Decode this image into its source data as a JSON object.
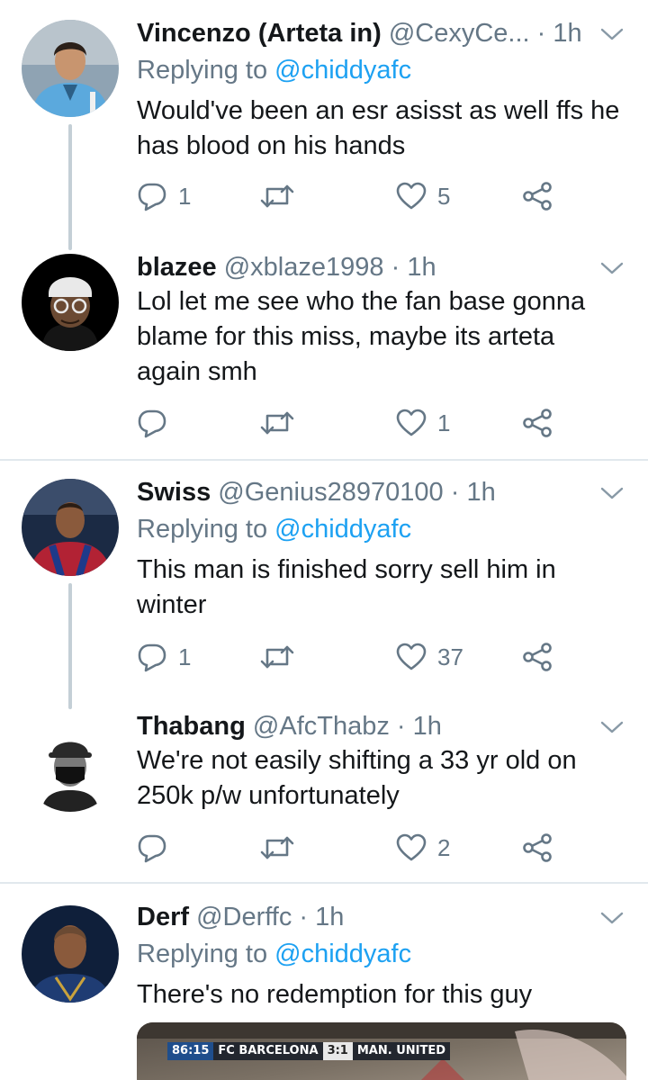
{
  "colors": {
    "text_primary": "#14171a",
    "text_secondary": "#657786",
    "link": "#1da1f2",
    "thread_line": "#c4cfd6",
    "divider": "#e1e8ed"
  },
  "icons": {
    "reply": "reply-icon",
    "retweet": "retweet-icon",
    "like": "heart-icon",
    "share": "share-icon",
    "more": "chevron-down-icon"
  },
  "tweets": [
    {
      "name": "Vincenzo (Arteta in)",
      "handle": "@CexyCe...",
      "dot": "·",
      "time": "1h",
      "replying_prefix": "Replying to",
      "replying_to": "@chiddyafc",
      "text": "Would've been an esr asisst as well ffs he has blood on his hands",
      "reply_count": "1",
      "like_count": "5"
    },
    {
      "name": "blazee",
      "handle": "@xblaze1998",
      "dot": "·",
      "time": "1h",
      "text": "Lol let me see who the fan base gonna blame for this miss, maybe its arteta again smh",
      "reply_count": "",
      "like_count": "1"
    },
    {
      "name": "Swiss",
      "handle": "@Genius28970100",
      "dot": "·",
      "time": "1h",
      "replying_prefix": "Replying to",
      "replying_to": "@chiddyafc",
      "text": "This man is finished sorry sell him in winter",
      "reply_count": "1",
      "like_count": "37"
    },
    {
      "name": "Thabang",
      "handle": "@AfcThabz",
      "dot": "·",
      "time": "1h",
      "text": "We're not easily shifting a 33 yr old on 250k p/w unfortunately",
      "reply_count": "",
      "like_count": "2"
    },
    {
      "name": "Derf",
      "handle": "@Derffc",
      "dot": "·",
      "time": "1h",
      "replying_prefix": "Replying to",
      "replying_to": "@chiddyafc",
      "text": "There's no redemption for this guy",
      "media": {
        "clock": "86:15",
        "home_team": "FC BARCELONA",
        "score": "3:1",
        "away_team": "MAN. UNITED"
      }
    }
  ]
}
